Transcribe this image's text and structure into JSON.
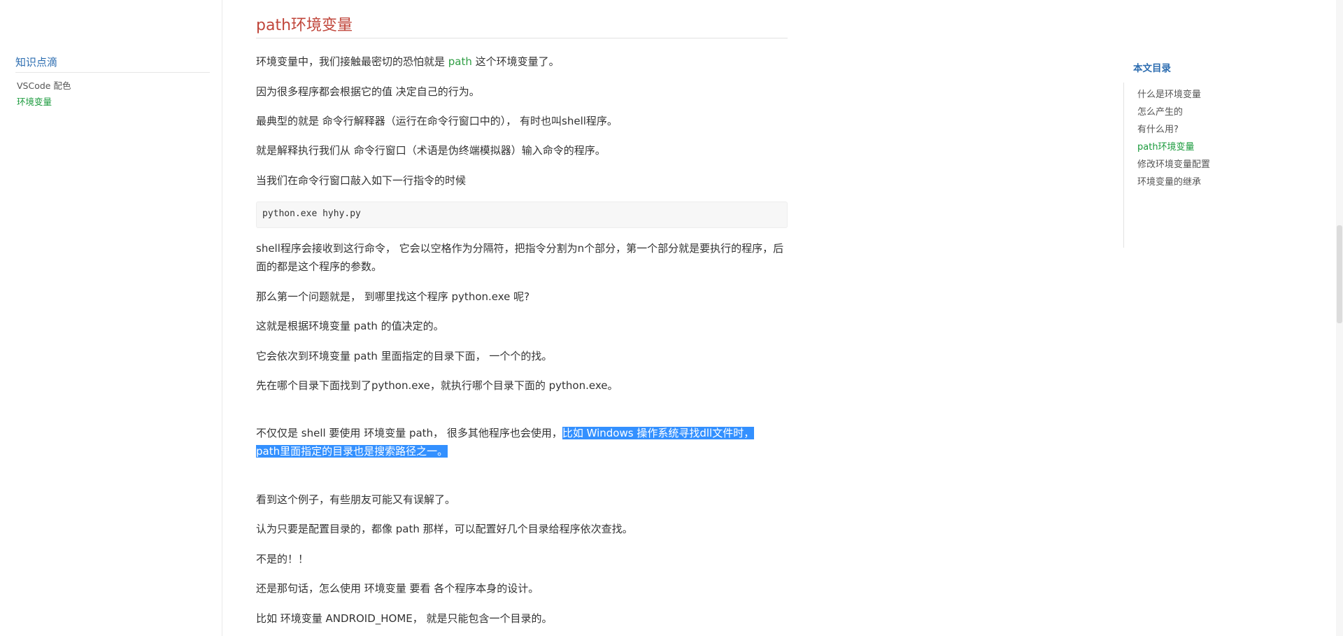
{
  "left_sidebar": {
    "title": "知识点滴",
    "items": [
      {
        "label": "VSCode 配色",
        "active": false
      },
      {
        "label": "环境变量",
        "active": true
      }
    ]
  },
  "article": {
    "heading": "path环境变量",
    "p1_before": "环境变量中，我们接触最密切的恐怕就是 ",
    "p1_path": "path",
    "p1_after": " 这个环境变量了。",
    "p2": "因为很多程序都会根据它的值 决定自己的行为。",
    "p3": "最典型的就是 命令行解释器（运行在命令行窗口中的）， 有时也叫shell程序。",
    "p4": "就是解释执行我们从 命令行窗口（术语是伪终端模拟器）输入命令的程序。",
    "p5": "当我们在命令行窗口敲入如下一行指令的时候",
    "code": "python.exe hyhy.py",
    "p6": "shell程序会接收到这行命令， 它会以空格作为分隔符，把指令分割为n个部分，第一个部分就是要执行的程序，后面的都是这个程序的参数。",
    "p7": "那么第一个问题就是， 到哪里找这个程序 python.exe 呢?",
    "p8": "这就是根据环境变量 path 的值决定的。",
    "p9": "它会依次到环境变量 path 里面指定的目录下面， 一个个的找。",
    "p10": "先在哪个目录下面找到了python.exe，就执行哪个目录下面的 python.exe。",
    "p11_plain": "不仅仅是 shell 要使用 环境变量 path， 很多其他程序也会使用，",
    "p11_selected_1": "比如 Windows 操作系统寻找dll文件时，",
    "p11_selected_2": "path里面指定的目录也是搜索路径之一。",
    "p12": "看到这个例子，有些朋友可能又有误解了。",
    "p13": "认为只要是配置目录的，都像 path 那样，可以配置好几个目录给程序依次查找。",
    "p14": "不是的！！",
    "p15": "还是那句话，怎么使用 环境变量 要看 各个程序本身的设计。",
    "p16": "比如 环境变量 ANDROID_HOME， 就是只能包含一个目录的。"
  },
  "toc": {
    "title": "本文目录",
    "items": [
      {
        "label": "什么是环境变量",
        "active": false
      },
      {
        "label": "怎么产生的",
        "active": false
      },
      {
        "label": "有什么用?",
        "active": false
      },
      {
        "label": "path环境变量",
        "active": true
      },
      {
        "label": "修改环境变量配置",
        "active": false
      },
      {
        "label": "环境变量的继承",
        "active": false
      }
    ]
  },
  "colors": {
    "link_blue": "#2b6cb0",
    "heading_red": "#c0463b",
    "active_green": "#1a9a3c",
    "selection_blue": "#3390ff"
  }
}
